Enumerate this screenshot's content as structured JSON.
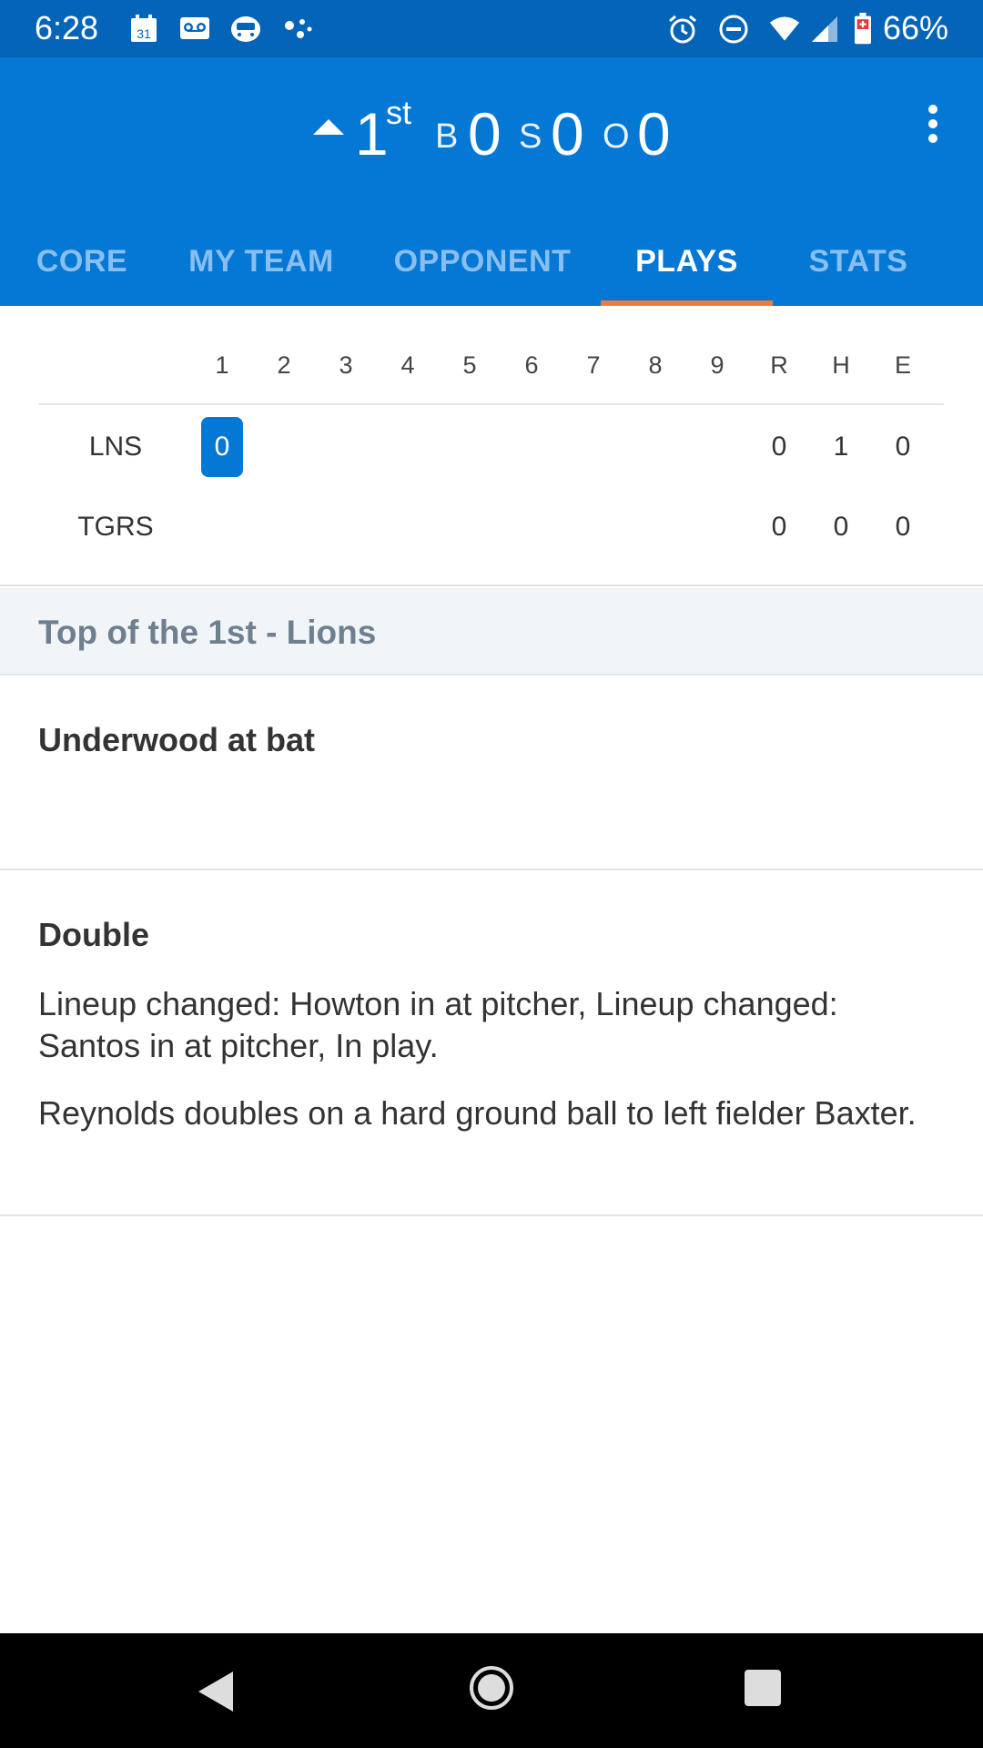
{
  "status_bar": {
    "time": "6:28",
    "battery": "66%",
    "icons": [
      "calendar-icon",
      "voicemail-icon",
      "bus-icon",
      "dots-icon",
      "alarm-icon",
      "dnd-icon",
      "wifi-icon",
      "signal-icon",
      "battery-icon"
    ],
    "calendar_day": "31"
  },
  "count": {
    "inning": "1",
    "inning_suffix": "st",
    "balls_label": "B",
    "balls": "0",
    "strikes_label": "S",
    "strikes": "0",
    "outs_label": "O",
    "outs": "0"
  },
  "tabs": [
    {
      "label": "CORE",
      "active": false
    },
    {
      "label": "MY TEAM",
      "active": false
    },
    {
      "label": "OPPONENT",
      "active": false
    },
    {
      "label": "PLAYS",
      "active": true
    },
    {
      "label": "STATS",
      "active": false
    }
  ],
  "scoreboard": {
    "columns": [
      "1",
      "2",
      "3",
      "4",
      "5",
      "6",
      "7",
      "8",
      "9",
      "R",
      "H",
      "E"
    ],
    "rows": [
      {
        "team": "LNS",
        "innings": [
          "0",
          "",
          "",
          "",
          "",
          "",
          "",
          "",
          ""
        ],
        "R": "0",
        "H": "1",
        "E": "0"
      },
      {
        "team": "TGRS",
        "innings": [
          "",
          "",
          "",
          "",
          "",
          "",
          "",
          "",
          ""
        ],
        "R": "0",
        "H": "0",
        "E": "0"
      }
    ]
  },
  "half_inning": "Top of the 1st - Lions",
  "plays": [
    {
      "title": "Underwood at bat",
      "descriptions": []
    },
    {
      "title": "Double",
      "descriptions": [
        "Lineup changed: Howton in at pitcher, Lineup changed: Santos in at pitcher, In play.",
        "Reynolds doubles on a hard ground ball to left fielder Baxter."
      ]
    }
  ],
  "colors": {
    "status_bar": "#0465b8",
    "app_bar": "#0478d4",
    "tab_indicator": "#f47a3a",
    "inactive_tab": "#89bff0"
  }
}
